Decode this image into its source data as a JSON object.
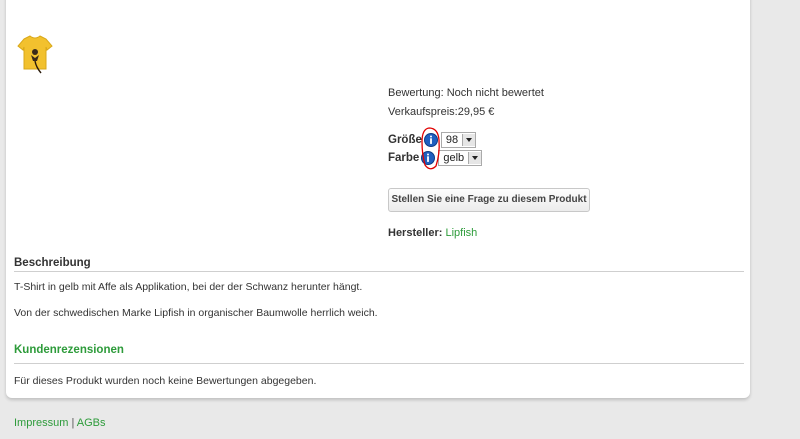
{
  "product": {
    "rating_text": "Bewertung: Noch nicht bewertet",
    "price_text": "Verkaufspreis:29,95 €",
    "options": [
      {
        "label": "Größe",
        "value": "98"
      },
      {
        "label": "Farbe",
        "value": "gelb"
      }
    ],
    "ask_button": "Stellen Sie eine Frage zu diesem Produkt",
    "manufacturer_label": "Hersteller:",
    "manufacturer_link": "Lipfish"
  },
  "description": {
    "title": "Beschreibung",
    "paragraphs": [
      "T-Shirt in gelb mit Affe als Applikation, bei der der Schwanz herunter hängt.",
      "Von der schwedischen Marke Lipfish in organischer Baumwolle herrlich weich."
    ]
  },
  "reviews": {
    "title": "Kundenrezensionen",
    "empty_text": "Für dieses Produkt wurden noch keine Bewertungen abgegeben."
  },
  "footer": {
    "links": [
      "Impressum",
      "AGBs"
    ],
    "separator": "|"
  },
  "colors": {
    "link_green": "#2d9b3a",
    "highlight_red": "#e00000",
    "info_blue": "#1f5fbf",
    "shirt_yellow": "#f2c12e"
  },
  "icons": {
    "thumbnail": "tshirt-monkey-thumbnail",
    "option_info": "info-icon"
  }
}
